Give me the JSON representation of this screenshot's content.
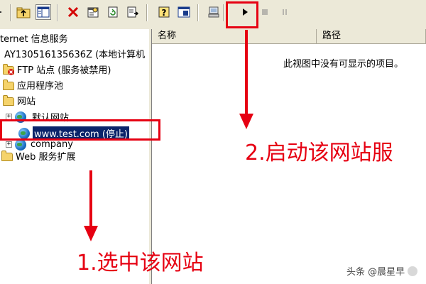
{
  "toolbar": {
    "buttons": [
      "up-folder",
      "show-hide-tree",
      "delete",
      "properties",
      "refresh",
      "export",
      "help",
      "console",
      "server",
      "start",
      "stop",
      "pause"
    ]
  },
  "tree": {
    "root_label": "ternet 信息服务",
    "computer_label": "AY130516135636Z (本地计算机",
    "ftp_label": "FTP 站点 (服务被禁用)",
    "app_pool_label": "应用程序池",
    "websites_label": "网站",
    "default_site_label": "默认网站",
    "selected_site_label": "www.test.com (停止)",
    "company_label": "company",
    "web_ext_label": "Web 服务扩展"
  },
  "list": {
    "col_name": "名称",
    "col_path": "路径",
    "empty_message": "此视图中没有可显示的项目。"
  },
  "annotations": {
    "step1": "1.选中该网站",
    "step2": "2.启动该网站服",
    "color": "#e60012"
  },
  "watermark": {
    "text": "头条 @晨星早"
  }
}
